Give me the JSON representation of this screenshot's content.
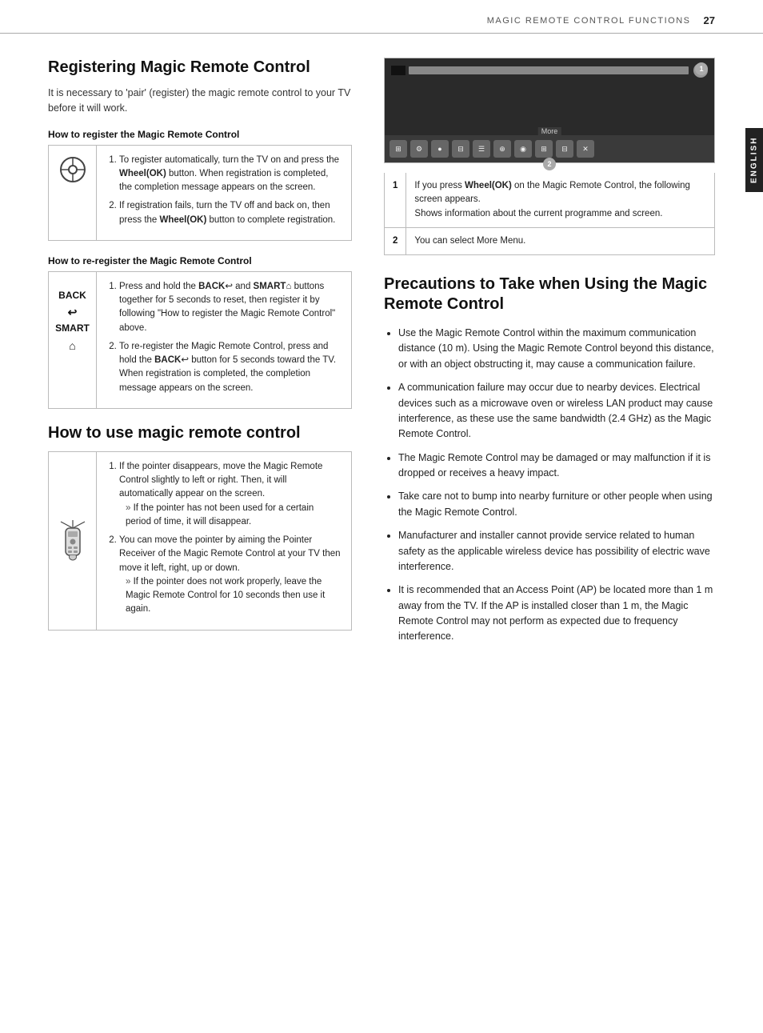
{
  "header": {
    "title": "MAGIC REMOTE CONTROL FUNCTIONS",
    "page_number": "27",
    "english_label": "ENGLISH"
  },
  "left": {
    "registering": {
      "title": "Registering Magic Remote Control",
      "desc": "It is necessary to 'pair' (register) the magic remote control to your TV before it will work.",
      "how_register": {
        "subtitle": "How to register the Magic Remote Control",
        "steps": [
          "To register automatically, turn the TV on and press the Wheel(OK) button. When registration is completed, the completion message appears on the screen.",
          "If registration fails, turn the TV off and back on, then press the Wheel(OK) button to complete registration."
        ],
        "step1_bold": "Wheel(OK)",
        "step2_bold": "Wheel(OK)"
      },
      "how_reregister": {
        "subtitle": "How to re-register the Magic Remote Control",
        "steps": [
          {
            "main": "Press and hold the BACK and SMART buttons together for 5 seconds to reset, then register it by following \"How to register the Magic Remote Control\" above.",
            "bold1": "BACK",
            "bold2": "SMART"
          },
          {
            "main": "To re-register the Magic Remote Control, press and hold the BACK button for 5 seconds toward the TV. When registration is completed, the completion message appears on the screen.",
            "bold1": "BACK"
          }
        ]
      }
    },
    "how_to_use": {
      "title": "How to use magic remote control",
      "steps": [
        {
          "num": 1,
          "parts": [
            "If the pointer disappears, move the Magic Remote Control slightly to left or right. Then, it will automatically appear on the screen.",
            {
              "sub": "If the pointer has not been used for a certain period of time, it will disappear."
            }
          ]
        },
        {
          "num": 2,
          "parts": [
            "You can move the pointer by aiming the Pointer Receiver of the Magic Remote Control at your TV then move it left, right, up or down.",
            {
              "sub": "If the pointer does not work properly, leave the Magic Remote Control for 10 seconds then use it again."
            }
          ]
        }
      ]
    }
  },
  "right": {
    "tv_image": {
      "badge1": "1",
      "badge2": "2",
      "toolbar_label": "More"
    },
    "tv_table": {
      "rows": [
        {
          "num": "1",
          "text": "If you press Wheel(OK) on the Magic Remote Control, the following screen appears.\nShows information about the current programme and screen.",
          "bold": "Wheel(OK)"
        },
        {
          "num": "2",
          "text": "You can select More Menu."
        }
      ]
    },
    "precautions": {
      "title": "Precautions to Take when Using the Magic Remote Control",
      "items": [
        "Use the Magic Remote Control within the maximum communication distance (10 m). Using the Magic Remote Control beyond this distance, or with an object obstructing it, may cause a communication failure.",
        "A communication failure may occur due to nearby devices. Electrical devices such as a microwave oven or wireless LAN product may cause interference, as these use the same bandwidth (2.4 GHz) as the Magic Remote Control.",
        "The Magic Remote Control may be damaged or may malfunction if it is dropped or receives a heavy impact.",
        "Take care not to bump into nearby furniture or other people when using the Magic Remote Control.",
        "Manufacturer and installer cannot provide service related to human safety as the applicable wireless device has possibility of electric wave interference.",
        "It is recommended that an Access Point (AP) be located more than 1 m away from the TV. If the AP is installed closer than 1 m, the Magic Remote Control may not perform as expected due to frequency interference."
      ]
    }
  }
}
